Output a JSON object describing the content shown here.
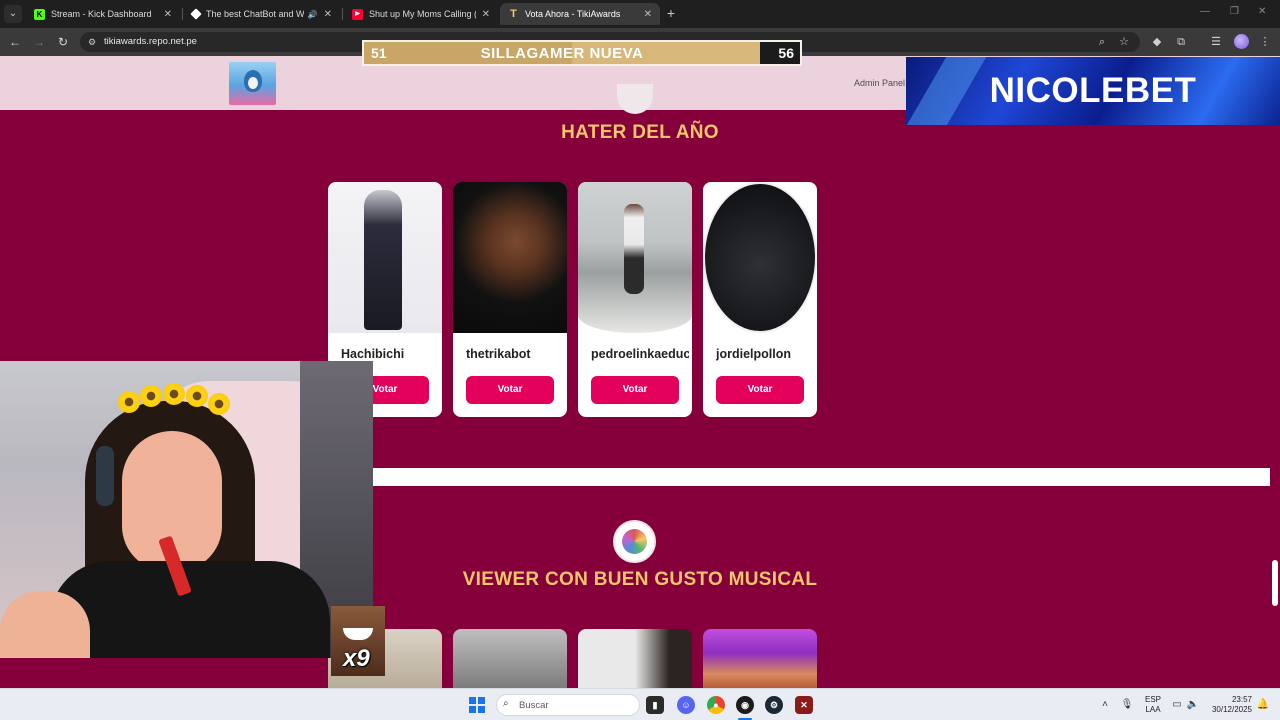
{
  "browser": {
    "tabs": [
      {
        "title": "Stream - Kick Dashboard",
        "icon": "kick-icon",
        "color": "#53fc18"
      },
      {
        "title": "The best ChatBot and Widg",
        "icon": "streamelements-icon",
        "color": "#ffffff"
      },
      {
        "title": "Shut up My Moms Calling (Spe",
        "icon": "youtube-icon",
        "color": "#ff0033"
      },
      {
        "title": "Vota Ahora - TikiAwards",
        "icon": "tikiawards-icon",
        "color": "#f6c66a"
      }
    ],
    "url": "tikiawards.repo.net.pe"
  },
  "page": {
    "admin_label": "Admin Panel",
    "categories": [
      {
        "title": "HATER DEL AÑO",
        "nominees": [
          {
            "name": "Hachibichi",
            "vote_label": "Votar"
          },
          {
            "name": "thetrikabot",
            "vote_label": "Votar"
          },
          {
            "name": "pedroelinkaeduc",
            "vote_label": "Votar"
          },
          {
            "name": "jordielpollon",
            "vote_label": "Votar"
          }
        ]
      },
      {
        "title": "VIEWER CON BUEN GUSTO MUSICAL"
      }
    ]
  },
  "overlay": {
    "score": {
      "left": "51",
      "title": "SILLAGAMER NUEVA",
      "right": "56",
      "left_fraction": 0.477
    },
    "sponsor": "NICOLEBET",
    "emote_count": "x9"
  },
  "taskbar": {
    "search_placeholder": "Buscar",
    "lang_top": "ESP",
    "lang_bottom": "LAA",
    "time": "23:57",
    "date": "30/12/2025"
  },
  "colors": {
    "page_bg": "#85003a",
    "title_gold": "#f6c66a",
    "vote_button": "#e2005a"
  }
}
